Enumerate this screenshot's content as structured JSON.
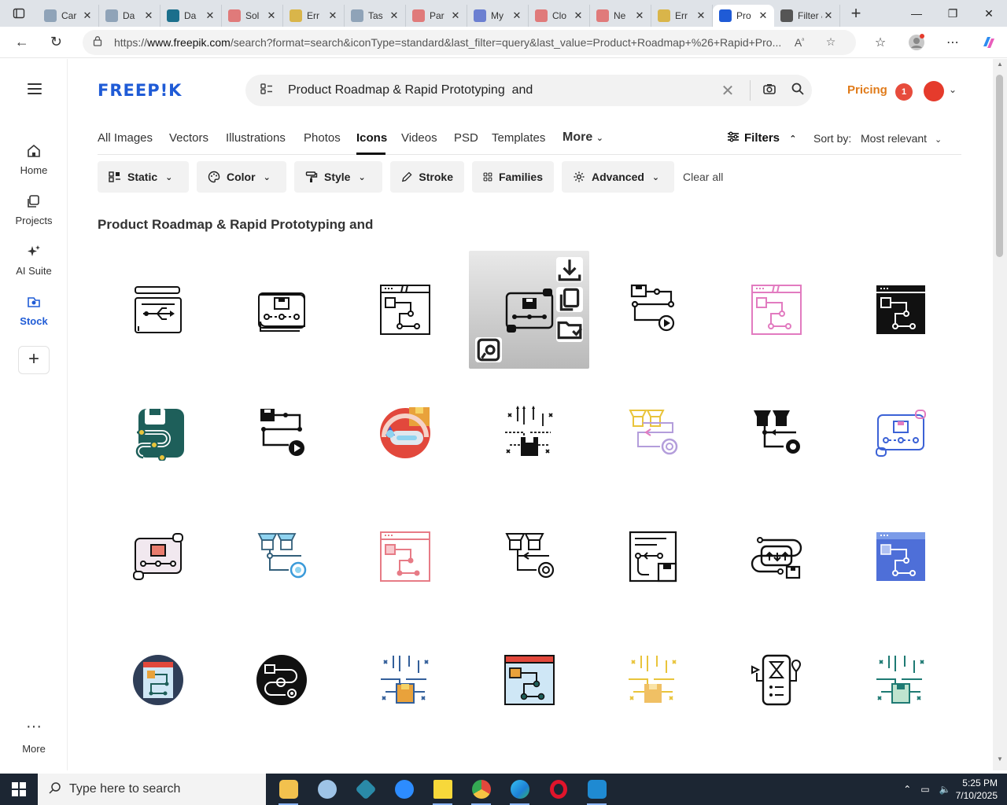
{
  "browser": {
    "tabs": [
      {
        "label": "Car",
        "color": "#8fa3b8"
      },
      {
        "label": "Da",
        "color": "#8fa3b8"
      },
      {
        "label": "Da",
        "color": "#1b6f8c"
      },
      {
        "label": "Sol",
        "color": "#e07a7a"
      },
      {
        "label": "Err",
        "color": "#d9b54a"
      },
      {
        "label": "Tas",
        "color": "#8fa3b8"
      },
      {
        "label": "Par",
        "color": "#e07a7a"
      },
      {
        "label": "My",
        "color": "#6b7fd1"
      },
      {
        "label": "Clo",
        "color": "#e07a7a"
      },
      {
        "label": "Ne",
        "color": "#e07a7a"
      },
      {
        "label": "Err",
        "color": "#d9b54a"
      },
      {
        "label": "Pro",
        "color": "#1f5bd6"
      },
      {
        "label": "Filter &",
        "color": "#555555"
      }
    ],
    "active_tab_index": 11,
    "url_prefix": "https://",
    "url_host": "www.freepik.com",
    "url_path": "/search?format=search&iconType=standard&last_filter=query&last_value=Product+Roadmap+%26+Rapid+Pro..."
  },
  "sidebar": {
    "items": [
      {
        "label": "Home",
        "icon": "home-icon"
      },
      {
        "label": "Projects",
        "icon": "projects-icon"
      },
      {
        "label": "AI Suite",
        "icon": "ai-suite-icon"
      },
      {
        "label": "Stock",
        "icon": "stock-icon"
      }
    ],
    "more_label": "More"
  },
  "header": {
    "logo": "FREEP!K",
    "search_value": "Product Roadmap & Rapid Prototyping  and",
    "pricing": "Pricing",
    "notification_count": "1"
  },
  "content_tabs": {
    "items": [
      "All Images",
      "Vectors",
      "Illustrations",
      "Photos",
      "Icons",
      "Videos",
      "PSD",
      "Templates"
    ],
    "more": "More",
    "active": "Icons",
    "filters": "Filters",
    "sort_label": "Sort by:",
    "sort_value": "Most relevant"
  },
  "filter_chips": [
    "Static",
    "Color",
    "Style",
    "Stroke",
    "Families",
    "Advanced"
  ],
  "clear_all": "Clear all",
  "results_title": "Product Roadmap & Rapid Prototyping and",
  "colors": {
    "brand": "#1f5bd6",
    "pricing": "#e07b1a",
    "teal": "#1e5f5a",
    "pink": "#e27bc0",
    "blue": "#3c62d6",
    "orange": "#e9a23b",
    "red": "#e2483c"
  },
  "taskbar": {
    "search_placeholder": "Type here to search",
    "time": "5:25 PM",
    "date": "7/10/2025"
  }
}
